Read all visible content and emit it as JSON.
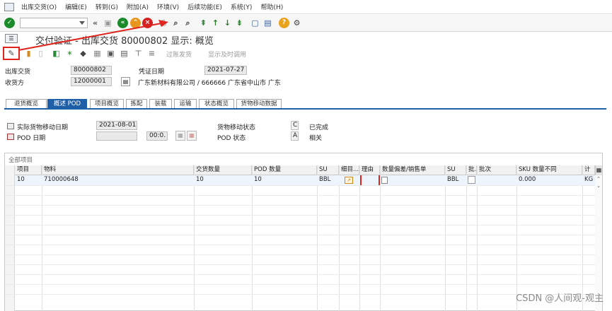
{
  "menu": {
    "items": [
      "出库交货(O)",
      "编辑(E)",
      "转到(G)",
      "附加(A)",
      "环境(V)",
      "后续功能(E)",
      "系统(Y)",
      "帮助(H)"
    ]
  },
  "title": "交付验证 - 出库交货 80000802 显示: 概览",
  "app_toolbar": {
    "post_goods": "过账发货",
    "display_call": "显示及时调用"
  },
  "header": {
    "delivery_label": "出库交货",
    "delivery_value": "80000802",
    "doc_date_label": "凭证日期",
    "doc_date_value": "2021-07-27",
    "ship_to_label": "收货方",
    "ship_to_value": "12000001",
    "ship_to_desc": "广东新材料有限公司 / 666666 广东省中山市 广东"
  },
  "tabs": [
    "退货概览",
    "概述 POD",
    "项目概览",
    "拣配",
    "装载",
    "运输",
    "状态概览",
    "货物移动数据"
  ],
  "pod": {
    "actual_gm_date_label": "实际货物移动日期",
    "actual_gm_date_value": "2021-08-01",
    "pod_date_label": "POD 日期",
    "pod_time_value": "00:0.",
    "gm_status_label": "货物移动状态",
    "gm_status_code": "C",
    "gm_status_text": "已完成",
    "pod_status_label": "POD 状态",
    "pod_status_code": "A",
    "pod_status_text": "相关"
  },
  "grid": {
    "title": "全部项目",
    "columns": [
      "项目",
      "物料",
      "交货数量",
      "POD 数量",
      "SU",
      "细目...",
      "理由",
      "数量偏差/销售单",
      "SU",
      "批.",
      "批次",
      "SKU 数量不同",
      "计"
    ],
    "rows": [
      {
        "item": "10",
        "material": "710000648",
        "qty": "10",
        "pod_qty": "10",
        "su": "BBL",
        "su2": "BBL",
        "sku_diff": "0.000",
        "unit": "KG"
      }
    ]
  },
  "watermark": "CSDN @人间观-观主",
  "colors": {
    "accent": "#1f5fa8",
    "highlight_box": "#e0231c",
    "green": "#1a8a2a",
    "orange": "#e8961e",
    "red": "#d42020"
  }
}
